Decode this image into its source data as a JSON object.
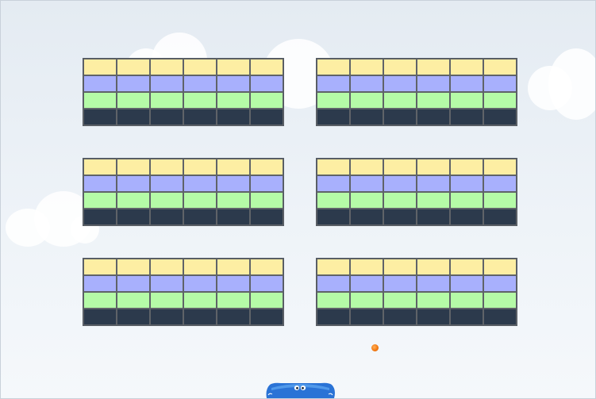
{
  "game": {
    "colors": {
      "row1": "#fdeea3",
      "row2": "#a8b0fd",
      "row3": "#b5fba7",
      "row4": "#2c3a4c",
      "ball": "#f37a12",
      "paddle": "#2a73d6"
    },
    "brick_groups": [
      {
        "rows": [
          "yellow",
          "blue",
          "green",
          "dark"
        ],
        "columns": 6
      },
      {
        "rows": [
          "yellow",
          "blue",
          "green",
          "dark"
        ],
        "columns": 6
      },
      {
        "rows": [
          "yellow",
          "blue",
          "green",
          "dark"
        ],
        "columns": 6
      },
      {
        "rows": [
          "yellow",
          "blue",
          "green",
          "dark"
        ],
        "columns": 6
      },
      {
        "rows": [
          "yellow",
          "blue",
          "green",
          "dark"
        ],
        "columns": 6
      },
      {
        "rows": [
          "yellow",
          "blue",
          "green",
          "dark"
        ],
        "columns": 6
      }
    ],
    "paddle_icon": "smiling-blob-paddle-icon",
    "ball_icon": "orange-ball-icon"
  }
}
